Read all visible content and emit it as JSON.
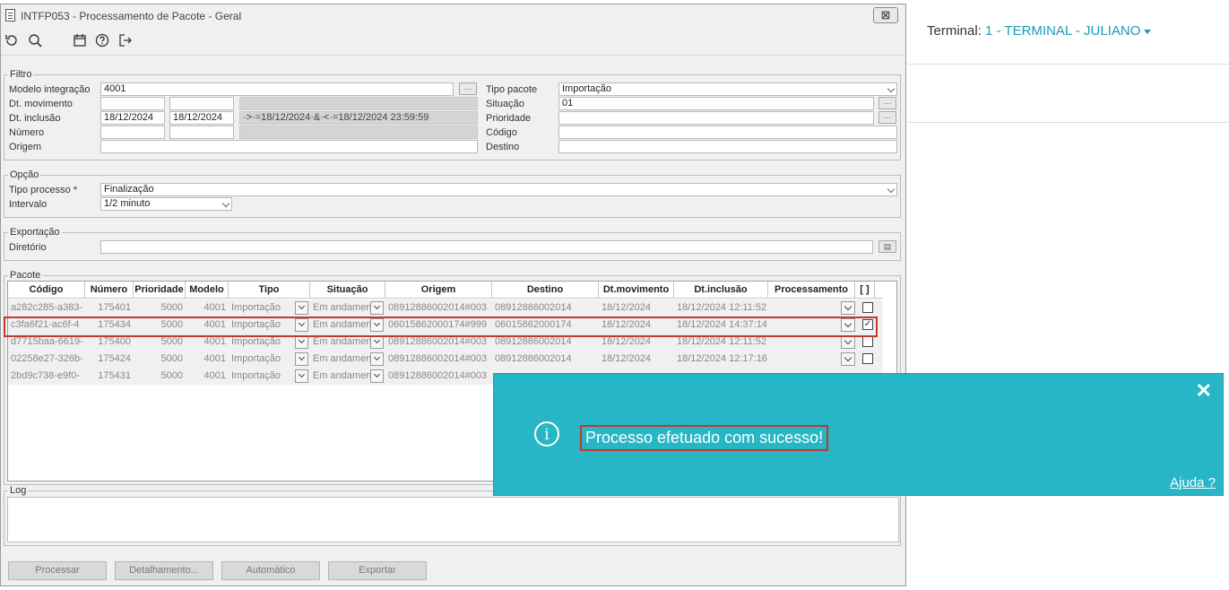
{
  "terminal": {
    "label": "Terminal:",
    "value": "1 - TERMINAL - JULIANO"
  },
  "window": {
    "title": "INTFP053 - Processamento de Pacote - Geral",
    "close": "⊠"
  },
  "toolbar": [
    "undo-icon",
    "search-icon",
    "calendar-icon",
    "help-icon",
    "exit-icon"
  ],
  "filtro": {
    "legend": "Filtro",
    "modelo_label": "Modelo integração",
    "modelo_value": "4001",
    "dtmov_label": "Dt. movimento",
    "dtinc_label": "Dt. inclusão",
    "dtinc_from": "18/12/2024",
    "dtinc_to": "18/12/2024",
    "dtinc_expr": "·>·=18/12/2024·&·<·=18/12/2024 23:59:59",
    "numero_label": "Número",
    "origem_label": "Origem",
    "tipo_label": "Tipo pacote",
    "tipo_value": "Importação",
    "situacao_label": "Situação",
    "situacao_value": "01",
    "prioridade_label": "Prioridade",
    "codigo_label": "Código",
    "destino_label": "Destino"
  },
  "opcao": {
    "legend": "Opção",
    "tipo_label": "Tipo processo *",
    "tipo_value": "Finalização",
    "intervalo_label": "Intervalo",
    "intervalo_value": "1/2 minuto"
  },
  "exportacao": {
    "legend": "Exportação",
    "dir_label": "Diretório"
  },
  "pacote": {
    "legend": "Pacote",
    "columns": [
      "Código",
      "Número",
      "Prioridade",
      "Modelo",
      "Tipo",
      "Situação",
      "Origem",
      "Destino",
      "Dt.movimento",
      "Dt.inclusão",
      "Processamento",
      "[ ]"
    ],
    "rows": [
      {
        "codigo": "a282c285-a383-",
        "numero": "175401",
        "prioridade": "5000",
        "modelo": "4001",
        "tipo": "Importação",
        "situacao": "Em andamen",
        "origem": "08912886002014#003",
        "destino": "08912886002014",
        "dtmov": "18/12/2024",
        "dtinc": "18/12/2024 12:11:52",
        "checked": ""
      },
      {
        "codigo": "c3fa6f21-ac6f-4",
        "numero": "175434",
        "prioridade": "5000",
        "modelo": "4001",
        "tipo": "Importação",
        "situacao": "Em andamen",
        "origem": "06015862000174#999",
        "destino": "06015862000174",
        "dtmov": "18/12/2024",
        "dtinc": "18/12/2024 14:37:14",
        "checked": "✓"
      },
      {
        "codigo": "d7715baa-6619-",
        "numero": "175400",
        "prioridade": "5000",
        "modelo": "4001",
        "tipo": "Importação",
        "situacao": "Em andamen",
        "origem": "08912886002014#003",
        "destino": "08912886002014",
        "dtmov": "18/12/2024",
        "dtinc": "18/12/2024 12:11:52",
        "checked": ""
      },
      {
        "codigo": "02258e27-326b-",
        "numero": "175424",
        "prioridade": "5000",
        "modelo": "4001",
        "tipo": "Importação",
        "situacao": "Em andamen",
        "origem": "08912886002014#003",
        "destino": "08912886002014",
        "dtmov": "18/12/2024",
        "dtinc": "18/12/2024 12:17:16",
        "checked": ""
      },
      {
        "codigo": "2bd9c738-e9f0-",
        "numero": "175431",
        "prioridade": "5000",
        "modelo": "4001",
        "tipo": "Importação",
        "situacao": "Em andamen",
        "origem": "08912886002014#003",
        "destino": "",
        "dtmov": "",
        "dtinc": "",
        "checked": ""
      }
    ]
  },
  "log": {
    "legend": "Log"
  },
  "buttons": {
    "processar": "Processar",
    "detalhamento": "Detalhamento...",
    "automatico": "Automático",
    "exportar": "Exportar"
  },
  "toast": {
    "message": "Processo efetuado com sucesso!",
    "help": "Ajuda ?",
    "close": "✕",
    "info": "i"
  }
}
